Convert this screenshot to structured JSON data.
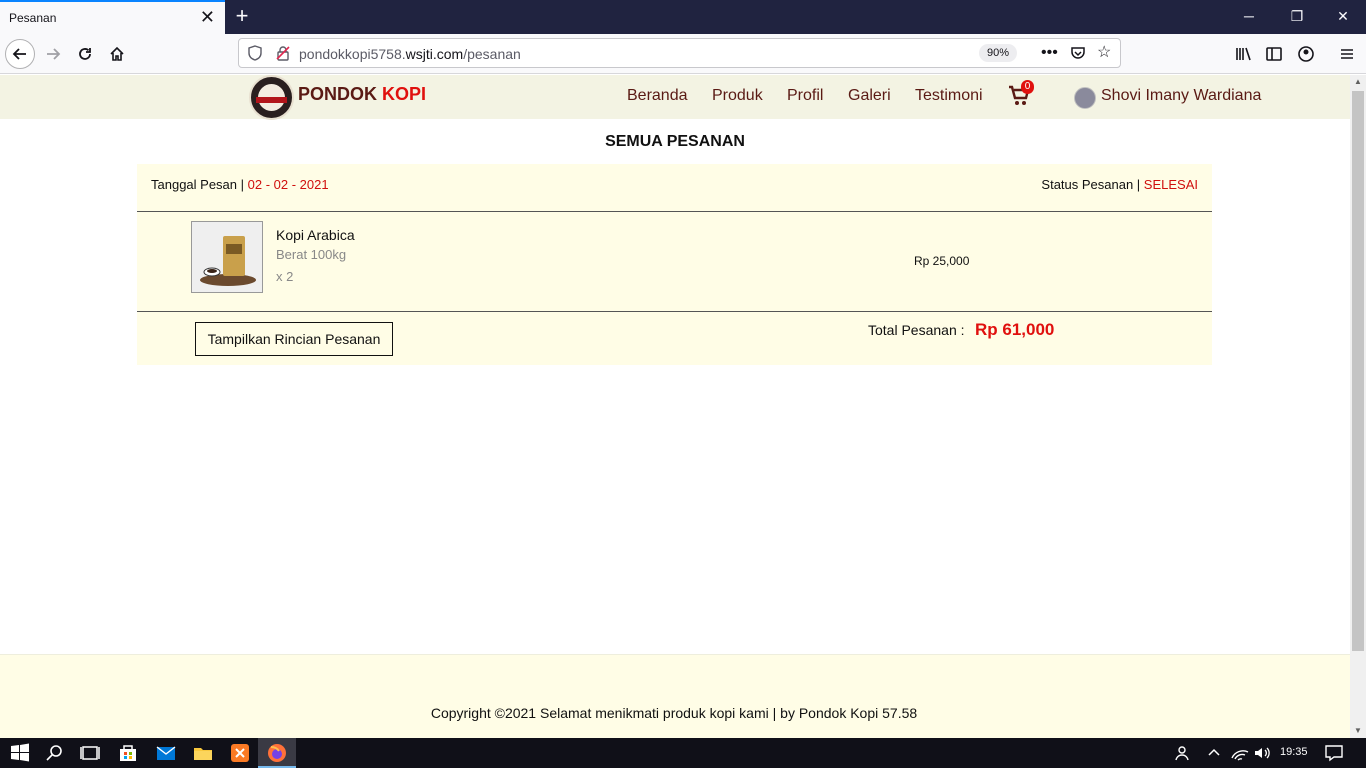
{
  "browser": {
    "tab_title": "Pesanan",
    "tab_close": "✕",
    "new_tab": "+",
    "url_host": "pondokkopi5758.",
    "url_domain": "wsjti.com",
    "url_path": "/pesanan",
    "zoom": "90%",
    "window_minimize": "─",
    "window_restore": "❐",
    "window_close": "✕"
  },
  "site": {
    "logo_word1": "PONDOK",
    "logo_word2": "KOPI",
    "nav": [
      "Beranda",
      "Produk",
      "Profil",
      "Galeri",
      "Testimoni"
    ],
    "cart_count": "0",
    "user_name": "Shovi Imany Wardiana"
  },
  "page": {
    "title": "SEMUA PESANAN"
  },
  "order": {
    "date_label": "Tanggal Pesan | ",
    "date_value": "02 - 02 - 2021",
    "status_label": "Status Pesanan | ",
    "status_value": "SELESAI",
    "item": {
      "name": "Kopi Arabica",
      "weight": "Berat 100kg",
      "qty": "x 2",
      "price": "Rp 25,000"
    },
    "detail_button": "Tampilkan Rincian Pesanan",
    "total_label": "Total Pesanan :",
    "total_value": "Rp 61,000"
  },
  "footer": {
    "text": "Copyright ©2021 Selamat menikmati produk kopi kami | by Pondok Kopi 57.58"
  },
  "taskbar": {
    "clock": "19:35"
  },
  "colors": {
    "accent_red": "#e0100e",
    "brand_brown": "#5a1a14",
    "card_bg": "#fffde6",
    "header_bg": "#f3f3e3"
  }
}
